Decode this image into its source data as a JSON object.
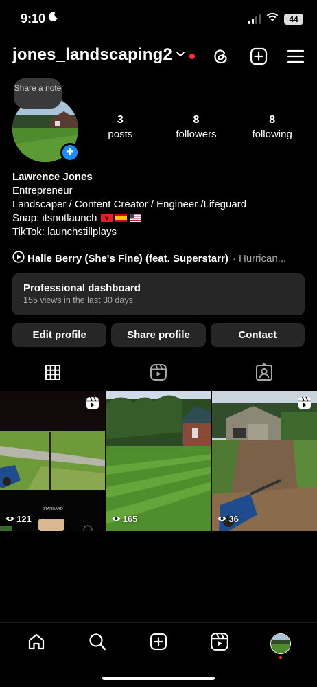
{
  "status_bar": {
    "time": "9:10",
    "battery": "44"
  },
  "header": {
    "username": "jones_landscaping2"
  },
  "profile": {
    "note": "Share a note",
    "stats": [
      {
        "value": "3",
        "label": "posts"
      },
      {
        "value": "8",
        "label": "followers"
      },
      {
        "value": "8",
        "label": "following"
      }
    ],
    "name": "Lawrence Jones",
    "category": "Entrepreneur",
    "bio_lines": [
      "Landscaper / Content Creator / Engineer /Lifeguard",
      "Snap: itsnotlaunch",
      "TikTok: launchstillplays"
    ],
    "music": {
      "song": "Halle Berry (She's Fine) (feat. Superstarr)",
      "artist": "· Hurrican..."
    }
  },
  "dashboard": {
    "title": "Professional dashboard",
    "subtitle": "155 views in the last 30 days."
  },
  "buttons": {
    "edit": "Edit profile",
    "share": "Share profile",
    "contact": "Contact"
  },
  "tabs": [
    "grid-icon",
    "reels-icon",
    "tagged-icon"
  ],
  "posts": [
    {
      "views": "121",
      "overlay_text": "STANDARD"
    },
    {
      "views": "165"
    },
    {
      "views": "36"
    }
  ],
  "nav": [
    "home-icon",
    "search-icon",
    "create-icon",
    "reels-icon",
    "profile-avatar"
  ],
  "colors": {
    "accent": "#1a8cff",
    "notification": "#ff2d3f",
    "surface": "#262626",
    "muted": "#a8a8a8"
  }
}
